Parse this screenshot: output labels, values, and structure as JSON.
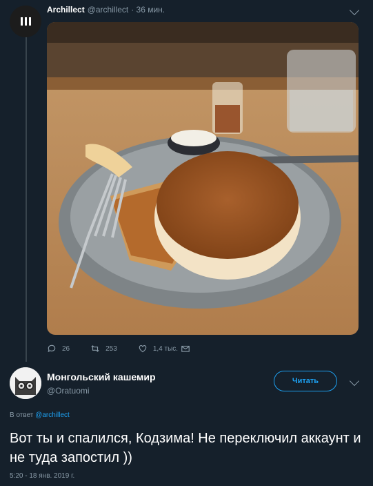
{
  "tweet1": {
    "author_name": "Archillect",
    "author_handle": "@archillect",
    "time": "· 36 мин.",
    "image_description": "",
    "stats": {
      "replies": "26",
      "retweets": "253",
      "likes": "1,4 тыс."
    }
  },
  "tweet2": {
    "author_name": "Монгольский кашемир",
    "author_handle": "@Oratuomi",
    "follow_label": "Читать",
    "reply_prefix": "В ответ",
    "reply_handle": "@archillect",
    "text": "Вот ты и спалился, Кодзима! Не переключил аккаунт и не туда запостил ))",
    "timestamp": "5:20 - 18 янв. 2019 г."
  },
  "colors": {
    "background": "#15202b",
    "muted": "#8899a6",
    "accent": "#1da1f2",
    "thread_line": "#38444d"
  },
  "icons": [
    "chevron-down-icon",
    "reply-icon",
    "retweet-icon",
    "like-icon",
    "message-icon"
  ]
}
